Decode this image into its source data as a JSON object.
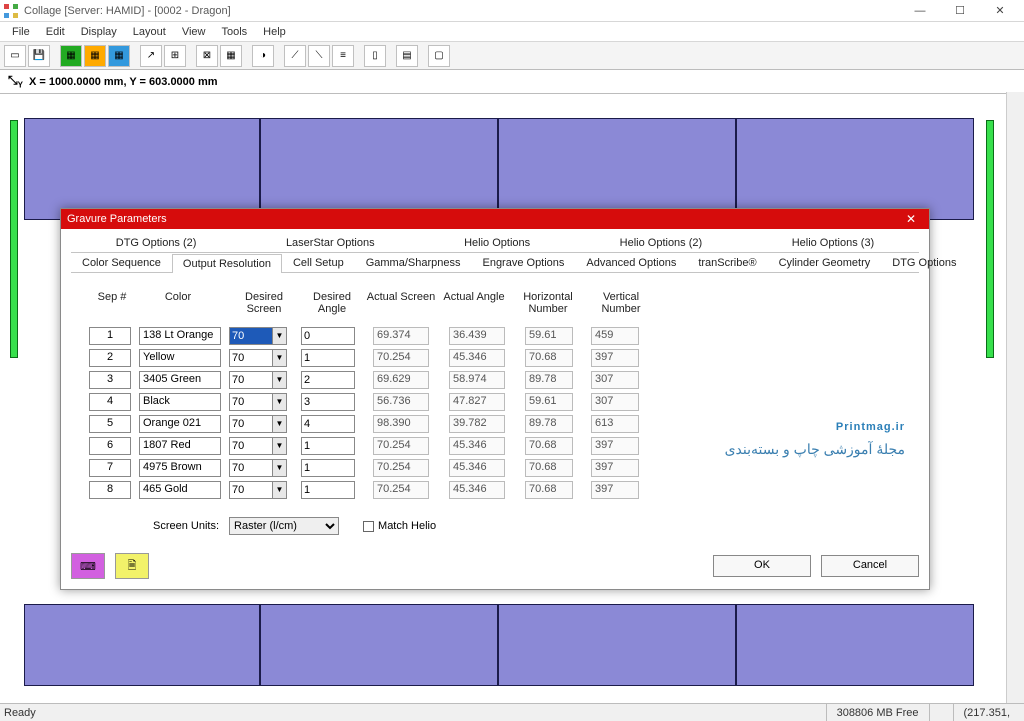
{
  "window": {
    "title": "Collage  [Server: HAMID] - [0002 - Dragon]"
  },
  "win_controls": {
    "min": "—",
    "max": "☐",
    "close": "✕"
  },
  "menu": [
    "File",
    "Edit",
    "Display",
    "Layout",
    "View",
    "Tools",
    "Help"
  ],
  "coord": {
    "text": "X = 1000.0000 mm, Y = 603.0000 mm"
  },
  "dialog": {
    "title": "Gravure Parameters",
    "tabs_row1": [
      "DTG Options (2)",
      "LaserStar Options",
      "Helio Options",
      "Helio Options (2)",
      "Helio Options (3)"
    ],
    "tabs_row2": [
      "Color Sequence",
      "Output Resolution",
      "Cell Setup",
      "Gamma/Sharpness",
      "Engrave Options",
      "Advanced Options",
      "tranScribe®",
      "Cylinder Geometry",
      "DTG Options"
    ],
    "headers": {
      "sep": "Sep #",
      "color": "Color",
      "ds": "Desired Screen",
      "da": "Desired Angle",
      "as": "Actual Screen",
      "aa": "Actual Angle",
      "hn": "Horizontal Number",
      "vn": "Vertical Number"
    },
    "rows": [
      {
        "sep": "1",
        "color": "138 Lt Orange",
        "ds": "70",
        "da": "0",
        "as": "69.374",
        "aa": "36.439",
        "hn": "59.61",
        "vn": "459",
        "sel": true
      },
      {
        "sep": "2",
        "color": "Yellow",
        "ds": "70",
        "da": "1",
        "as": "70.254",
        "aa": "45.346",
        "hn": "70.68",
        "vn": "397"
      },
      {
        "sep": "3",
        "color": "3405 Green",
        "ds": "70",
        "da": "2",
        "as": "69.629",
        "aa": "58.974",
        "hn": "89.78",
        "vn": "307"
      },
      {
        "sep": "4",
        "color": "Black",
        "ds": "70",
        "da": "3",
        "as": "56.736",
        "aa": "47.827",
        "hn": "59.61",
        "vn": "307"
      },
      {
        "sep": "5",
        "color": "Orange 021",
        "ds": "70",
        "da": "4",
        "as": "98.390",
        "aa": "39.782",
        "hn": "89.78",
        "vn": "613"
      },
      {
        "sep": "6",
        "color": "1807 Red",
        "ds": "70",
        "da": "1",
        "as": "70.254",
        "aa": "45.346",
        "hn": "70.68",
        "vn": "397"
      },
      {
        "sep": "7",
        "color": "4975 Brown",
        "ds": "70",
        "da": "1",
        "as": "70.254",
        "aa": "45.346",
        "hn": "70.68",
        "vn": "397"
      },
      {
        "sep": "8",
        "color": "465 Gold",
        "ds": "70",
        "da": "1",
        "as": "70.254",
        "aa": "45.346",
        "hn": "70.68",
        "vn": "397"
      }
    ],
    "units_label": "Screen Units:",
    "units_value": "Raster (l/cm)",
    "match_helio": "Match Helio",
    "ok": "OK",
    "cancel": "Cancel"
  },
  "watermark": {
    "big": "Printmag.ir",
    "sub": "مجلهٔ آموزشی چاپ و بسته‌بندی"
  },
  "status": {
    "ready": "Ready",
    "mem": "308806 MB Free",
    "pos": "(217.351,"
  }
}
